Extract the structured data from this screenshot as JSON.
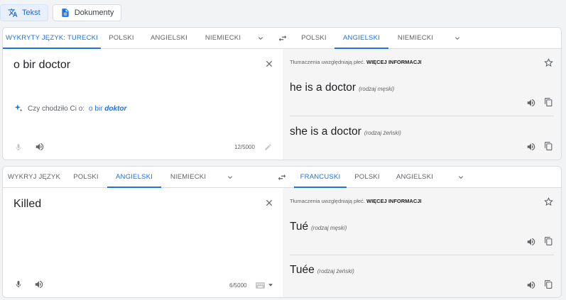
{
  "mode_buttons": [
    {
      "label": "Tekst",
      "icon": "translate-icon"
    },
    {
      "label": "Dokumenty",
      "icon": "document-icon"
    }
  ],
  "panels": [
    {
      "source_tabs": [
        "WYKRYTY JĘZYK: TURECKI",
        "POLSKI",
        "ANGIELSKI",
        "NIEMIECKI"
      ],
      "target_tabs": [
        "POLSKI",
        "ANGIELSKI",
        "NIEMIECKI"
      ],
      "active_source_tab": 0,
      "active_target_tab": 1,
      "source_text": "o bir doctor",
      "suggestion": {
        "prefix": "Czy chodziło Ci o:",
        "normal": "o bir",
        "emph": "doktor"
      },
      "char_count": "12/5000",
      "gender_note": "Tłumaczenia uwzględniają płeć.",
      "gender_link": "WIĘCEJ INFORMACJI",
      "results": [
        {
          "text": "he is a doctor",
          "gender": "(rodzaj męski)"
        },
        {
          "text": "she is a doctor",
          "gender": "(rodzaj żeński)"
        }
      ]
    },
    {
      "source_tabs": [
        "WYKRYJ JĘZYK",
        "POLSKI",
        "ANGIELSKI",
        "NIEMIECKI"
      ],
      "target_tabs": [
        "FRANCUSKI",
        "POLSKI",
        "ANGIELSKI"
      ],
      "active_source_tab": 2,
      "active_target_tab": 0,
      "source_text": "Killed",
      "char_count": "6/5000",
      "gender_note": "Tłumaczenia uwzględniają płeć.",
      "gender_link": "WIĘCEJ INFORMACJI",
      "results": [
        {
          "text": "Tué",
          "gender": "(rodzaj męski)"
        },
        {
          "text": "Tuée",
          "gender": "(rodzaj żeński)"
        }
      ]
    }
  ],
  "colors": {
    "accent": "#1a73e8",
    "text": "#202124",
    "muted": "#5f6368"
  }
}
